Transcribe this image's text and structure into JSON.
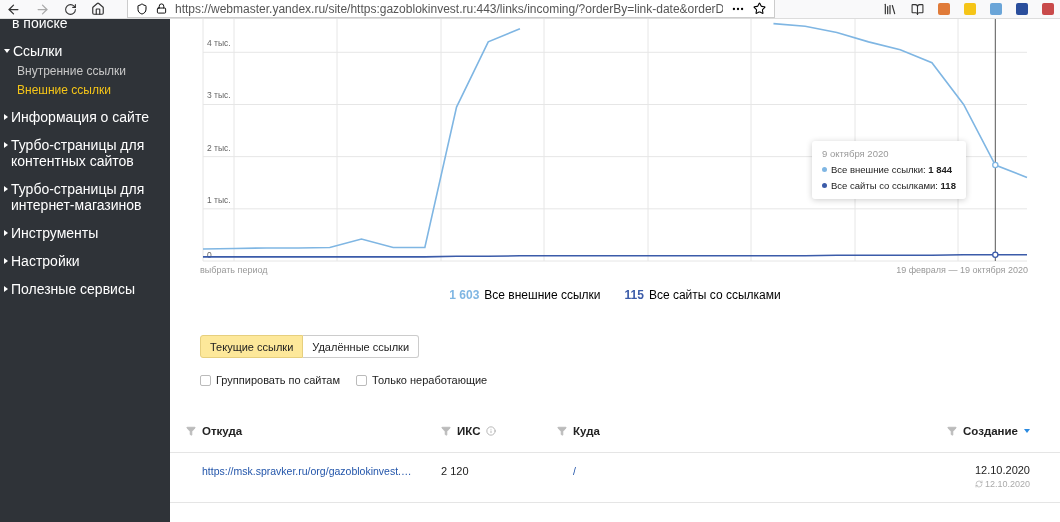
{
  "browser": {
    "url": "https://webmaster.yandex.ru/site/https:gazoblokinvest.ru:443/links/incoming/?orderBy=link-date&orderD"
  },
  "sidebar": {
    "items": [
      {
        "label": "в поиске",
        "kind": "fragment"
      },
      {
        "label": "Ссылки",
        "kind": "section",
        "expanded": true,
        "children": [
          {
            "label": "Внутренние ссылки",
            "selected": false
          },
          {
            "label": "Внешние ссылки",
            "selected": true
          }
        ]
      },
      {
        "label": "Информация о сайте",
        "kind": "section",
        "expanded": false
      },
      {
        "label": "Турбо-страницы для контентных сайтов",
        "kind": "section",
        "expanded": false
      },
      {
        "label": "Турбо-страницы для интернет-магазинов",
        "kind": "section",
        "expanded": false
      },
      {
        "label": "Инструменты",
        "kind": "section",
        "expanded": false
      },
      {
        "label": "Настройки",
        "kind": "section",
        "expanded": false
      },
      {
        "label": "Полезные сервисы",
        "kind": "section",
        "expanded": false
      }
    ]
  },
  "chart": {
    "period_link": "выбрать период",
    "range": "19 февраля — 19 октября 2020",
    "tooltip": {
      "date": "9 октября 2020",
      "rows": [
        {
          "label": "Все внешние ссылки: ",
          "value": "1 844",
          "color": "#7fb6e3"
        },
        {
          "label": "Все сайты со ссылками: ",
          "value": "118",
          "color": "#3b5ba9"
        }
      ]
    },
    "chart_data": {
      "type": "line",
      "grid": true,
      "categories": [
        null,
        null,
        null,
        null,
        null,
        null,
        null,
        null,
        null,
        null,
        null,
        null,
        null,
        null,
        null,
        null,
        null,
        null,
        null,
        null,
        null,
        null,
        null,
        null,
        null,
        null,
        null
      ],
      "ylim": [
        0,
        4.6
      ],
      "yticks": [
        {
          "value": 0,
          "label": "0"
        },
        {
          "value": 1,
          "label": "1 тыс."
        },
        {
          "value": 2,
          "label": "2 тыс."
        },
        {
          "value": 3,
          "label": "3 тыс."
        },
        {
          "value": 4,
          "label": "4 тыс."
        }
      ],
      "series": [
        {
          "name": "Все внешние ссылки",
          "color": "#7fb6e3",
          "values": [
            0.23,
            0.24,
            0.25,
            0.25,
            0.26,
            0.42,
            0.26,
            0.26,
            2.95,
            4.2,
            4.45,
            null,
            null,
            null,
            null,
            null,
            null,
            null,
            4.55,
            4.5,
            4.38,
            4.2,
            4.05,
            3.8,
            3.0,
            1.84,
            1.6
          ]
        },
        {
          "name": "Все сайты со ссылками",
          "color": "#3b5ba9",
          "values": [
            0.08,
            0.08,
            0.08,
            0.08,
            0.08,
            0.08,
            0.08,
            0.08,
            0.09,
            0.09,
            0.1,
            0.1,
            0.1,
            0.1,
            0.1,
            0.1,
            0.1,
            0.1,
            0.1,
            0.1,
            0.11,
            0.11,
            0.11,
            0.11,
            0.12,
            0.12,
            0.12
          ]
        }
      ]
    },
    "totals": [
      "1 603",
      "115"
    ]
  },
  "tabs": [
    {
      "label": "Текущие ссылки",
      "selected": true
    },
    {
      "label": "Удалённые ссылки",
      "selected": false
    }
  ],
  "filters": [
    {
      "label": "Группировать по сайтам",
      "checked": false
    },
    {
      "label": "Только неработающие",
      "checked": false
    }
  ],
  "table": {
    "columns": [
      {
        "label": "Откуда",
        "hint": false,
        "sorted": false
      },
      {
        "label": "ИКС",
        "hint": true,
        "sorted": false
      },
      {
        "label": "Куда",
        "hint": false,
        "sorted": false
      },
      {
        "label": "Создание",
        "hint": false,
        "sorted": true
      }
    ],
    "rows": [
      {
        "source": "https://msk.spravker.ru/org/gazoblokinvest.…",
        "iks": "2 120",
        "target": "/",
        "created": "12.10.2020",
        "checked": "12.10.2020"
      }
    ]
  }
}
